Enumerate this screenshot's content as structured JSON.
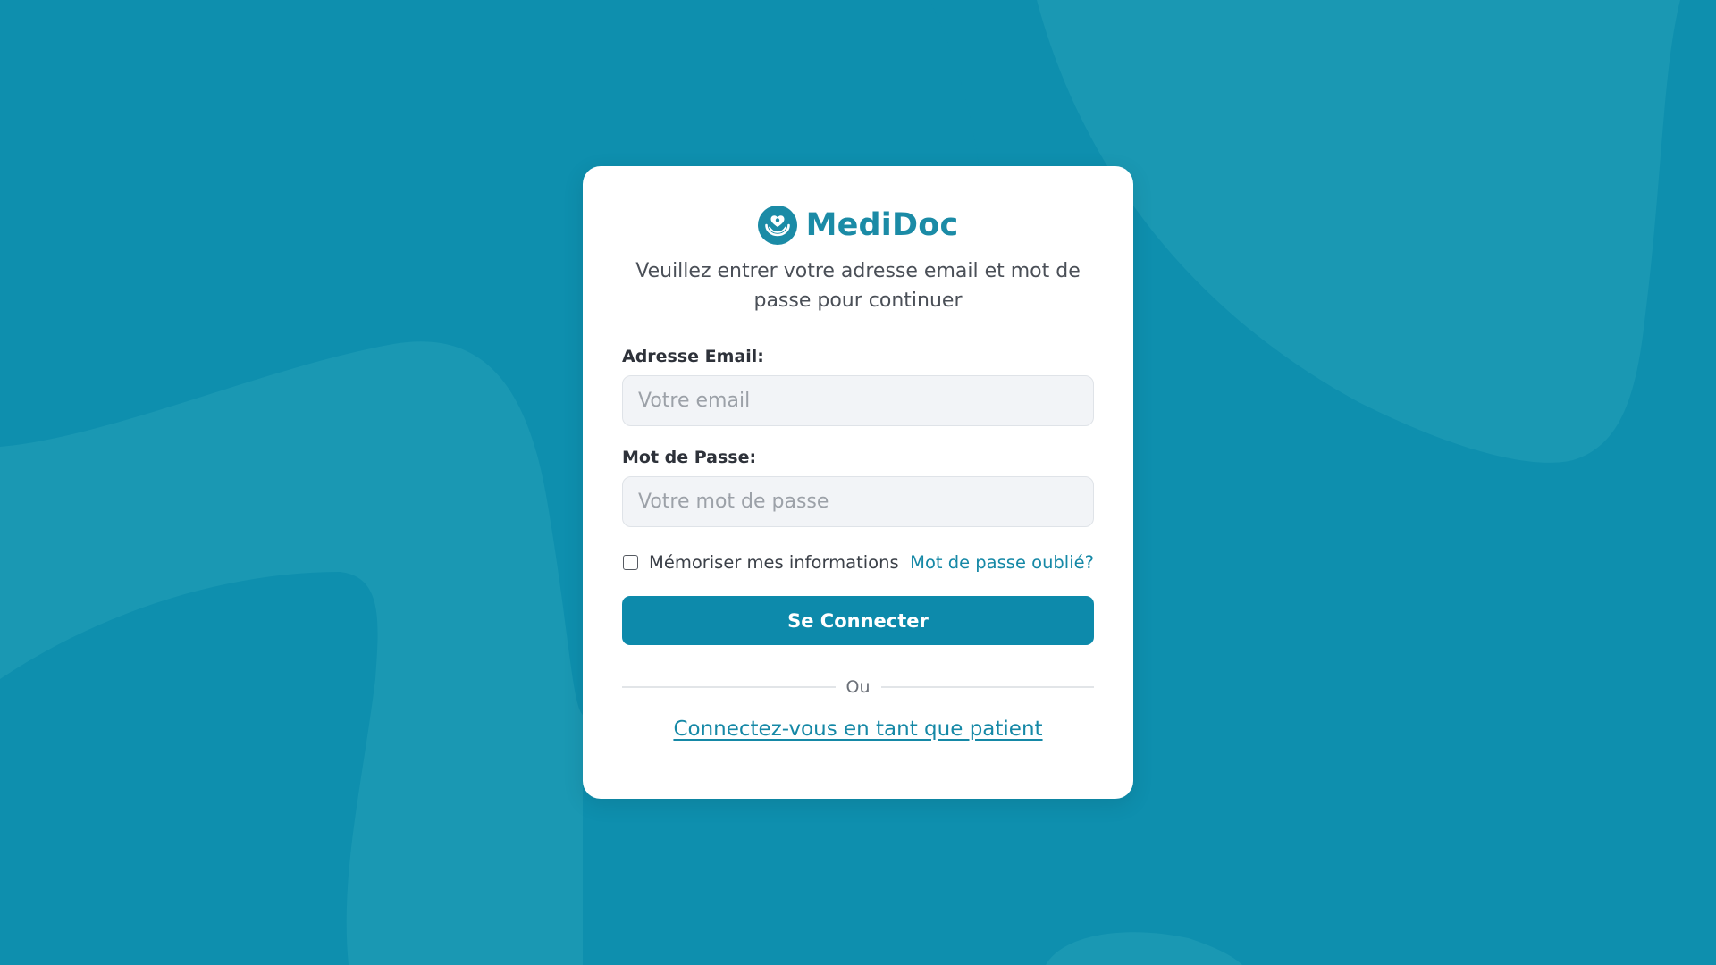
{
  "colors": {
    "background": "#0e8fae",
    "background_shape": "#1a98b3",
    "brand": "#1b8ba6",
    "primary_button": "#0d8aab",
    "link": "#1588a6"
  },
  "brand": {
    "name": "MediDoc",
    "logo_icon": "heart-in-hands-icon"
  },
  "login": {
    "subtitle": "Veuillez entrer votre adresse email et mot de passe pour continuer",
    "email": {
      "label": "Adresse Email:",
      "placeholder": "Votre email",
      "value": ""
    },
    "password": {
      "label": "Mot de Passe:",
      "placeholder": "Votre mot de passe",
      "value": ""
    },
    "remember": {
      "label": "Mémoriser mes informations",
      "checked": false
    },
    "forgot_label": "Mot de passe oublié?",
    "submit_label": "Se Connecter",
    "divider_label": "Ou",
    "patient_link_label": "Connectez-vous en tant que patient"
  }
}
